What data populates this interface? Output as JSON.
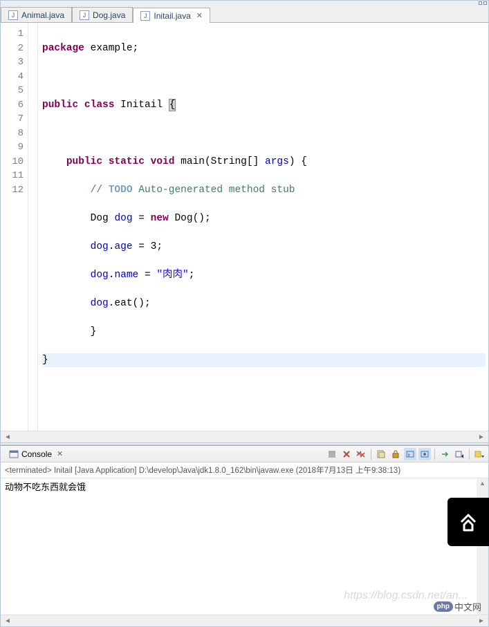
{
  "tabs": [
    {
      "label": "Animal.java"
    },
    {
      "label": "Dog.java"
    },
    {
      "label": "Initail.java"
    }
  ],
  "code": {
    "line1": {
      "kw1": "package",
      "t1": " example;"
    },
    "line3": {
      "kw1": "public",
      "kw2": " class",
      "t1": " Initail ",
      "t2": "{"
    },
    "line5": {
      "kw1": "public",
      "kw2": " static",
      "kw3": " void",
      "t1": " main(String[] ",
      "id1": "args",
      "t2": ") {"
    },
    "line6": {
      "cm1": "// ",
      "todo": "TODO",
      "cm2": " Auto-generated method stub"
    },
    "line7": {
      "t1": "Dog ",
      "id1": "dog",
      "t2": " = ",
      "kw1": "new",
      "t3": " Dog();"
    },
    "line8": {
      "id1": "dog",
      "t1": ".",
      "id2": "age",
      "t2": " = 3;"
    },
    "line9": {
      "id1": "dog",
      "t1": ".",
      "id2": "name",
      "t2": " = ",
      "str": "\"肉肉\"",
      "t3": ";"
    },
    "line10": {
      "id1": "dog",
      "t1": ".eat();"
    },
    "line11": "        }",
    "line12": "}"
  },
  "line_numbers": [
    "1",
    "2",
    "3",
    "4",
    "5",
    "6",
    "7",
    "8",
    "9",
    "10",
    "11",
    "12"
  ],
  "console": {
    "title": "Console",
    "status": "<terminated> Initail [Java Application] D:\\develop\\Java\\jdk1.8.0_162\\bin\\javaw.exe (2018年7月13日 上午9:38:13)",
    "output": "动物不吃东西就会饿"
  },
  "watermark": "https://blog.csdn.net/an...",
  "logo": {
    "pill": "php",
    "text": "中文网"
  }
}
